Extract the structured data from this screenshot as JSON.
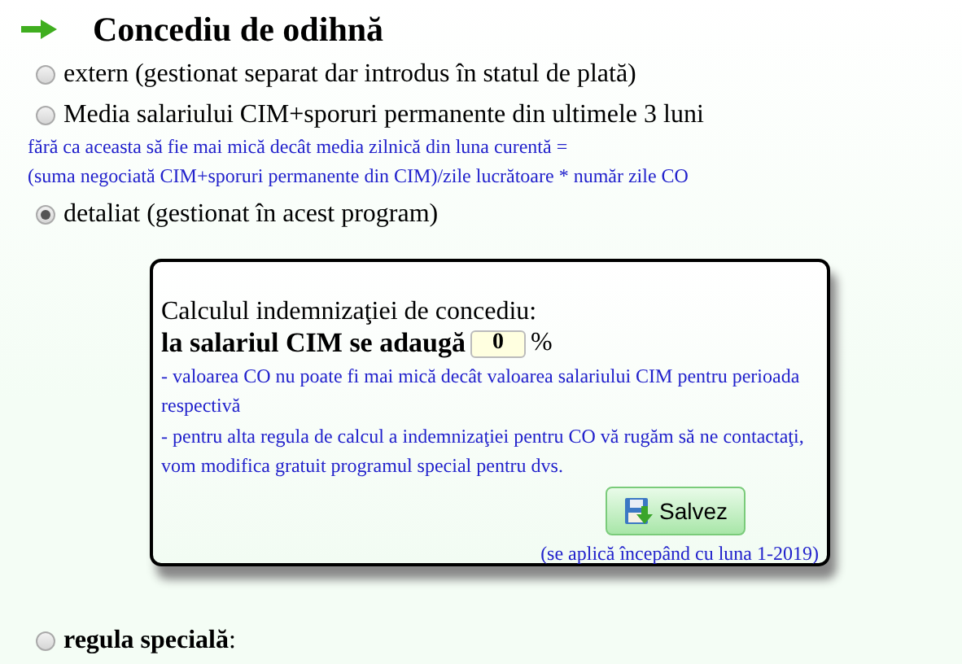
{
  "title": "Concediu de odihnă",
  "options": [
    {
      "label": "extern (gestionat separat dar introdus în statul de plată)",
      "selected": false
    },
    {
      "label": "Media salariului CIM+sporuri permanente din ultimele 3 luni",
      "selected": false,
      "note": [
        "fără ca aceasta să fie mai mică decât media zilnică din luna curentă =",
        "(suma negociată CIM+sporuri permanente din CIM)/zile lucrătoare * număr zile CO"
      ]
    },
    {
      "label": "detaliat (gestionat în acest program)",
      "selected": true
    },
    {
      "label": "**regula specială**:",
      "selected": false
    }
  ],
  "panel": {
    "heading": "Calculul indemnizaţiei de concediu:",
    "field_label": "la salariul CIM se adaugă",
    "field_value": "0",
    "unit": "%",
    "notes": [
      "- valoarea CO nu poate fi mai mică decât valoarea salariului CIM pentru perioada respectivă",
      "- pentru alta regula de calcul a indemnizaţiei pentru CO vă rugăm să ne contactaţi, vom modifica gratuit programul special pentru dvs."
    ],
    "button": "Salvez",
    "footnote": "(se aplică începând cu luna 1-2019)"
  }
}
